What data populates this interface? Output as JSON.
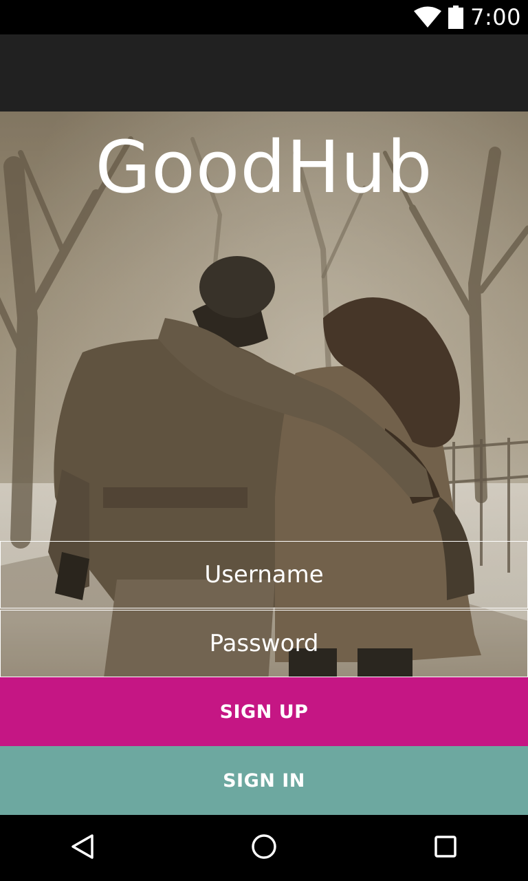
{
  "status_bar": {
    "time": "7:00",
    "icons": [
      "wifi-icon",
      "battery-icon"
    ]
  },
  "app": {
    "title": "GoodHub"
  },
  "form": {
    "username_placeholder": "Username",
    "password_placeholder": "Password"
  },
  "buttons": {
    "sign_up": "SIGN UP",
    "sign_in": "SIGN IN"
  },
  "nav_bar": {
    "icons": [
      "back-icon",
      "home-icon",
      "recents-icon"
    ]
  },
  "colors": {
    "sign_up": "#c51684",
    "sign_in": "#6da8a0",
    "action_bar": "#212121",
    "status_bar": "#000000"
  }
}
